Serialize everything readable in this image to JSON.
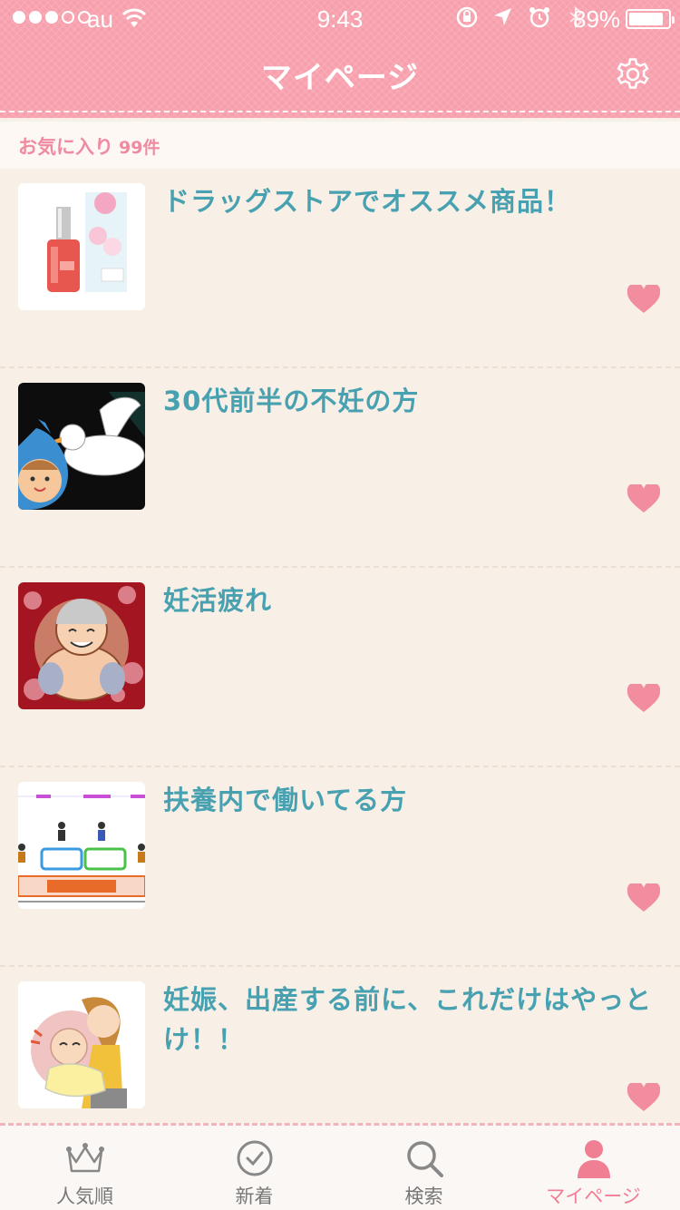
{
  "status_bar": {
    "carrier": "au",
    "time": "9:43",
    "battery": "89%",
    "battery_level": 0.89,
    "signal_bars_filled": 3,
    "signal_bars_total": 5
  },
  "header": {
    "title": "マイページ",
    "settings_icon": "gear-icon"
  },
  "favorites": {
    "label": "お気に入り",
    "count": "99件"
  },
  "items": [
    {
      "title": "ドラッグストアでオススメ商品！",
      "thumb": "nail-polish"
    },
    {
      "title": "30代前半の不妊の方",
      "thumb": "stork-baby"
    },
    {
      "title": "妊活疲れ",
      "thumb": "smiling-figure"
    },
    {
      "title": "扶養内で働いてる方",
      "thumb": "pension-chart"
    },
    {
      "title": "妊娠、出産する前に、これだけはやっとけ！！",
      "thumb": "mother-baby"
    }
  ],
  "tabs": [
    {
      "label": "人気順",
      "icon": "crown-icon"
    },
    {
      "label": "新着",
      "icon": "clock-icon"
    },
    {
      "label": "検索",
      "icon": "search-icon"
    },
    {
      "label": "マイページ",
      "icon": "person-icon",
      "active": true
    }
  ],
  "colors": {
    "header": "#f7a0ad",
    "title_text": "#48a1b0",
    "heart": "#f28da0",
    "accent": "#f07f93"
  }
}
